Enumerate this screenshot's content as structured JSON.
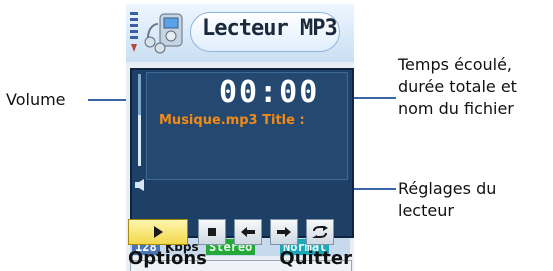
{
  "title": "Lecteur MP3",
  "player": {
    "time": "00:00",
    "file_line": "Musique.mp3  Title :",
    "volume_level": 0.55
  },
  "status": {
    "bitrate": "128",
    "bitrate_unit": "Kbps",
    "channel": "Stereo",
    "mode": "Normal"
  },
  "softkeys": {
    "left": "Options",
    "right": "Quitter"
  },
  "callouts": {
    "volume": "Volume",
    "time_info_line1": "Temps écoulé,",
    "time_info_line2": "durée totale et",
    "time_info_line3": "nom du fichier",
    "settings_line1": "Réglages du",
    "settings_line2": "lecteur"
  },
  "colors": {
    "accent": "#3b66a6",
    "screen": "#1e3f66",
    "file_text": "#f08a18",
    "stereo_badge": "#24a83a",
    "normal_badge": "#1ca7b8",
    "bitrate_badge": "#4a73b3"
  },
  "icons": {
    "signal": "signal-bars-icon",
    "mp3_player": "mp3-player-icon",
    "play": "play-icon",
    "stop": "stop-icon",
    "previous": "arrow-left-icon",
    "next": "arrow-right-icon",
    "repeat": "repeat-icon",
    "volume": "speaker-icon"
  }
}
